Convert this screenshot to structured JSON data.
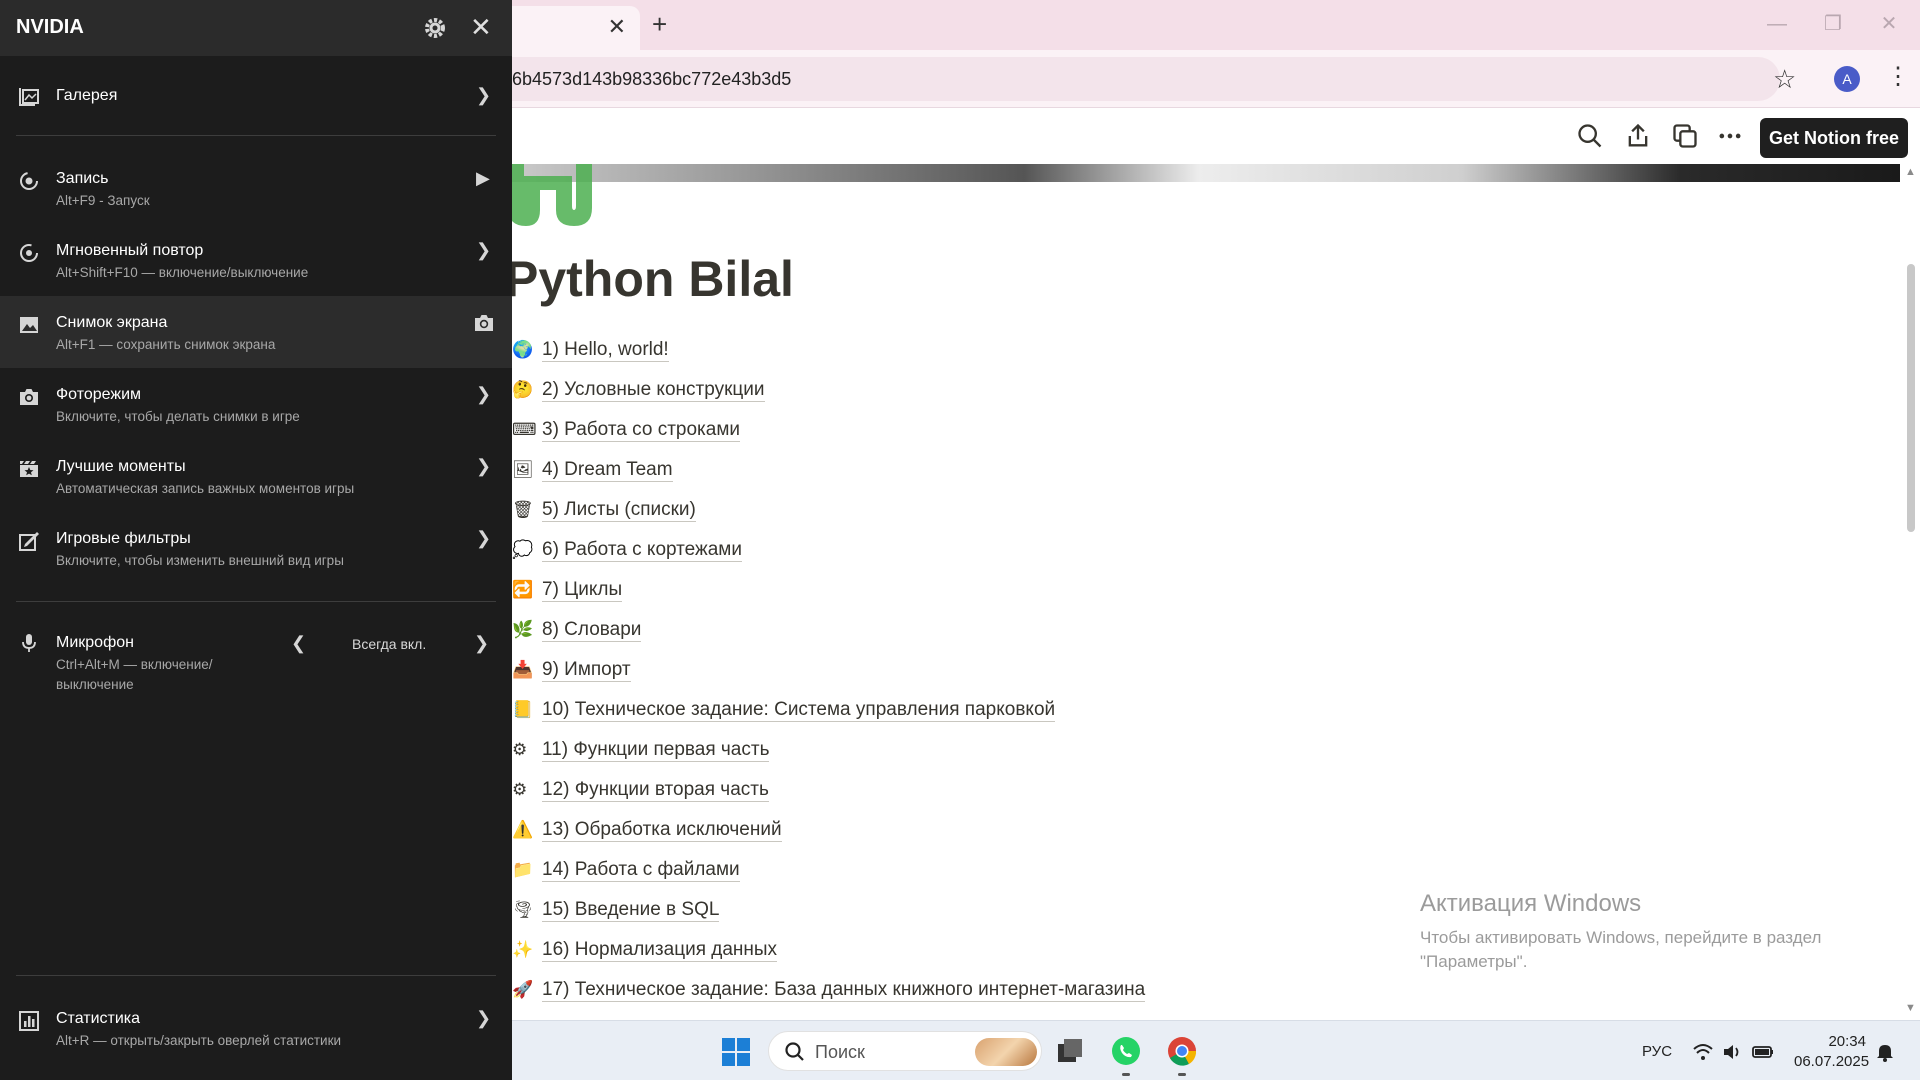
{
  "browser": {
    "url": "6b4573d143b98336bc772e43b3d5",
    "tab_close": "✕",
    "new_tab": "+",
    "profile_initial": "A",
    "window_controls": {
      "minimize": "—",
      "restore": "❐",
      "close": "✕"
    }
  },
  "notion": {
    "get_notion_label": "Get Notion free",
    "page_title": "Python Bilal",
    "items": [
      {
        "emoji": "🌍",
        "label": "1) Hello, world!"
      },
      {
        "emoji": "🤔",
        "label": "2) Условные конструкции"
      },
      {
        "emoji": "⌨",
        "label": "3) Работа со строками"
      },
      {
        "emoji": "🖼",
        "label": "4) Dream Team"
      },
      {
        "emoji": "🗑",
        "label": "5) Листы (списки)"
      },
      {
        "emoji": "💭",
        "label": "6) Работа с кортежами"
      },
      {
        "emoji": "🔁",
        "label": "7) Циклы"
      },
      {
        "emoji": "🌿",
        "label": "8) Словари"
      },
      {
        "emoji": "📥",
        "label": "9) Импорт"
      },
      {
        "emoji": "📒",
        "label": "10) Техническое задание: Система управления парковкой"
      },
      {
        "emoji": "⚙",
        "label": "11) Функции первая часть"
      },
      {
        "emoji": "⚙",
        "label": "12) Функции вторая часть"
      },
      {
        "emoji": "⚠️",
        "label": "13) Обработка исключений"
      },
      {
        "emoji": "📁",
        "label": "14) Работа с файлами"
      },
      {
        "emoji": "🌪",
        "label": "15) Введение в SQL"
      },
      {
        "emoji": "✨",
        "label": "16) Нормализация данных"
      },
      {
        "emoji": "🚀",
        "label": "17) Техническое задание: База данных книжного интернет-магазина"
      }
    ],
    "activation_title": "Активация Windows",
    "activation_text": "Чтобы активировать Windows, перейдите в раздел \"Параметры\"."
  },
  "nvidia": {
    "title": "NVIDIA",
    "close": "✕",
    "gallery": {
      "label": "Галерея"
    },
    "record": {
      "label": "Запись",
      "sub": "Alt+F9 - Запуск"
    },
    "instant_replay": {
      "label": "Мгновенный повтор",
      "sub": "Alt+Shift+F10 — включение/выключение"
    },
    "screenshot": {
      "label": "Снимок экрана",
      "sub": "Alt+F1 — сохранить снимок экрана"
    },
    "photo_mode": {
      "label": "Фоторежим",
      "sub": "Включите, чтобы делать снимки в игре"
    },
    "highlights": {
      "label": "Лучшие моменты",
      "sub": "Автоматическая запись важных моментов игры"
    },
    "game_filters": {
      "label": "Игровые фильтры",
      "sub": "Включите, чтобы изменить внешний вид игры"
    },
    "microphone": {
      "label": "Микрофон",
      "sub_line1": "Ctrl+Alt+M — включение/",
      "sub_line2": "выключение",
      "value": "Всегда вкл."
    },
    "stats": {
      "label": "Статистика",
      "sub": "Alt+R — открыть/закрыть оверлей статистики"
    }
  },
  "taskbar": {
    "search_placeholder": "Поиск",
    "language": "РУС",
    "time": "20:34",
    "date": "06.07.2025"
  },
  "colors": {
    "nvidia_panel": "#1c1c1c",
    "nvidia_header": "#2b2b2b",
    "nvidia_active_row": "#2c2c2c",
    "chrome_tabbar": "#f4dfe8",
    "notion_text": "#37352f",
    "whatsapp": "#25d366"
  },
  "icons": [
    "settings-gear-icon",
    "gallery-icon",
    "record-icon",
    "replay-icon",
    "image-icon",
    "camera-icon",
    "highlights-icon",
    "filters-icon",
    "microphone-icon",
    "stats-icon",
    "search-icon",
    "share-icon",
    "duplicate-icon",
    "more-icon",
    "star-icon",
    "windows-start-icon",
    "wifi-icon",
    "volume-icon",
    "battery-icon",
    "notifications-icon"
  ]
}
